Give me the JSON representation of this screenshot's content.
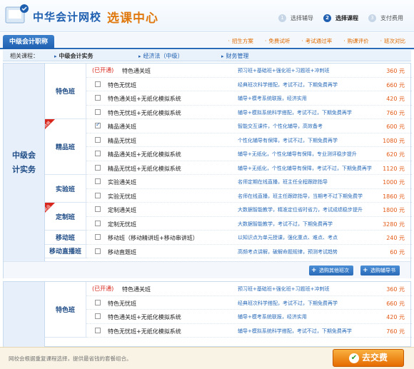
{
  "header": {
    "site_name": "中华会计网校",
    "site_sub": "选课中心",
    "steps": [
      {
        "num": "1",
        "label": "选择辅导"
      },
      {
        "num": "2",
        "label": "选择课程"
      },
      {
        "num": "3",
        "label": "支付费用"
      }
    ]
  },
  "nav": {
    "tab": "中级会计职称",
    "links": [
      "招生方案",
      "免费试听",
      "考试通过率",
      "购课评价",
      "班次对比"
    ]
  },
  "courses": {
    "label": "相关课程：",
    "items": [
      "中级会计实务",
      "经济法（中级）",
      "财务管理"
    ]
  },
  "section1": {
    "subject": "中级会计实务",
    "categories": [
      {
        "label": "特色班",
        "ribbon": ""
      },
      {
        "label": "精品班",
        "ribbon": "热销"
      },
      {
        "label": "实验班",
        "ribbon": ""
      },
      {
        "label": "定制班",
        "ribbon": "新品"
      },
      {
        "label": "移动班",
        "ribbon": ""
      },
      {
        "label": "移动直播班",
        "ribbon": ""
      }
    ],
    "rows": [
      {
        "opened": "(已开通)",
        "name": "特色通关班",
        "desc": "预习班+基础班+强化班+习题班+冲刺班",
        "price": "360 元",
        "checked": false
      },
      {
        "opened": "",
        "name": "特色无忧班",
        "desc": "经典班次科学搭配，考试不过，下期免费再学",
        "price": "660 元",
        "checked": false
      },
      {
        "opened": "",
        "name": "特色通关班+无纸化模拟系统",
        "desc": "辅导+模考系统联报，经济实用",
        "price": "420 元",
        "checked": false
      },
      {
        "opened": "",
        "name": "特色无忧班+无纸化模拟系统",
        "desc": "辅导+模拟系统科学搭配，考试不过，下期免费再学",
        "price": "760 元",
        "checked": false
      },
      {
        "opened": "",
        "name": "精品通关班",
        "desc": "智能交互课件，个性化辅导，高效备考",
        "price": "600 元",
        "checked": true
      },
      {
        "opened": "",
        "name": "精品无忧班",
        "desc": "个性化辅导有保障，考试不过，下期免费再学",
        "price": "1080 元",
        "checked": false
      },
      {
        "opened": "",
        "name": "精品通关班+无纸化模拟系统",
        "desc": "辅导+无纸化，个性化辅导有保障，专业测评稳步提升",
        "price": "620 元",
        "checked": false
      },
      {
        "opened": "",
        "name": "精品无忧班+无纸化模拟系统",
        "desc": "辅导+无纸化，个性化辅导有保障，考试不过，下期免费再学",
        "price": "1120 元",
        "checked": false
      },
      {
        "opened": "",
        "name": "实验通关班",
        "desc": "名师定期在线直播，班主任全程跟踪指导",
        "price": "1000 元",
        "checked": false
      },
      {
        "opened": "",
        "name": "实验无忧班",
        "desc": "名师在线直播，班主任跟踪指导，当期考不过下期免费学",
        "price": "1860 元",
        "checked": false
      },
      {
        "opened": "",
        "name": "定制通关班",
        "desc": "大数据智能教学，精准定位省时省力，考试成绩稳步提升",
        "price": "1800 元",
        "checked": false
      },
      {
        "opened": "",
        "name": "定制无忧班",
        "desc": "大数据智能教学，考试不过，下期免费再学",
        "price": "3280 元",
        "checked": false
      },
      {
        "opened": "",
        "name": "移动班（移动精讲班+移动串讲班）",
        "desc": "以知识点为单元授课，强化重点、难点、考点",
        "price": "240 元",
        "checked": false
      },
      {
        "opened": "",
        "name": "移动直题班",
        "desc": "高频考点讲解，破解命题规律，预测考试趋势",
        "price": "60 元",
        "checked": false
      }
    ],
    "actions": [
      "选购其他班次",
      "选购辅导书"
    ]
  },
  "section2": {
    "categories": [
      {
        "label": "特色班",
        "ribbon": ""
      }
    ],
    "rows": [
      {
        "opened": "(已开通)",
        "name": "特色通关班",
        "desc": "预习班+基础班+强化班+习题班+冲刺班",
        "price": "360 元",
        "checked": false
      },
      {
        "opened": "",
        "name": "特色无忧班",
        "desc": "经典班次科学搭配，考试不过，下期免费再学",
        "price": "660 元",
        "checked": false
      },
      {
        "opened": "",
        "name": "特色通关班+无纸化模拟系统",
        "desc": "辅导+模考系统联报，经济实用",
        "price": "420 元",
        "checked": false
      },
      {
        "opened": "",
        "name": "特色无忧班+无纸化模拟系统",
        "desc": "辅导+模拟系统科学搭配，考试不过，下期免费再学",
        "price": "760 元",
        "checked": false
      }
    ]
  },
  "footer": {
    "note": "网校会根据重复课程选择，提供最省钱的套餐组合。",
    "checkout": "去交费"
  },
  "colors": {
    "brand": "#1f5fb0",
    "accent": "#e07a10",
    "price": "#e35a16"
  }
}
